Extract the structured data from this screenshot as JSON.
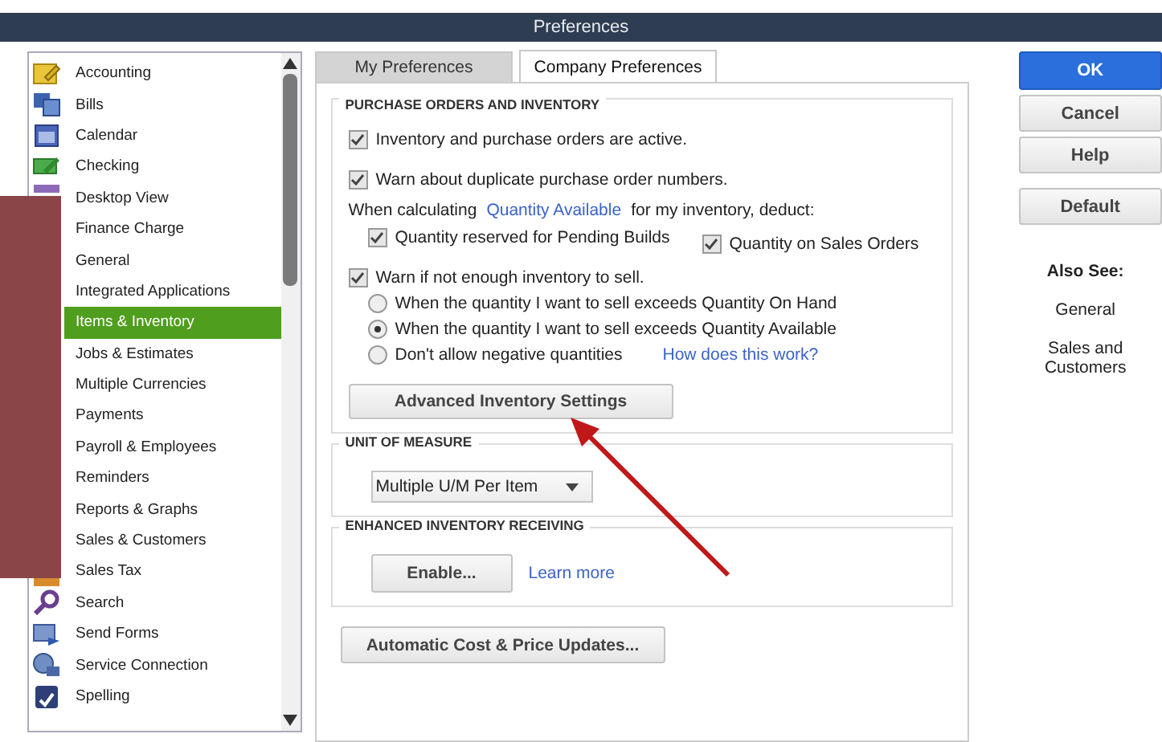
{
  "window": {
    "title": "Preferences"
  },
  "categories": [
    {
      "label": "Accounting",
      "kind": "ledger",
      "selected": false
    },
    {
      "label": "Bills",
      "kind": "bills",
      "selected": false
    },
    {
      "label": "Calendar",
      "kind": "calendar",
      "selected": false
    },
    {
      "label": "Checking",
      "kind": "check",
      "selected": false
    },
    {
      "label": "Desktop View",
      "kind": "screen",
      "selected": false
    },
    {
      "label": "Finance Charge",
      "selected": false
    },
    {
      "label": "General",
      "selected": false
    },
    {
      "label": "Integrated Applications",
      "selected": false
    },
    {
      "label": "Items & Inventory",
      "selected": true
    },
    {
      "label": "Jobs & Estimates",
      "selected": false
    },
    {
      "label": "Multiple Currencies",
      "selected": false
    },
    {
      "label": "Payments",
      "selected": false
    },
    {
      "label": "Payroll & Employees",
      "selected": false
    },
    {
      "label": "Reminders",
      "selected": false
    },
    {
      "label": "Reports & Graphs",
      "selected": false
    },
    {
      "label": "Sales & Customers",
      "selected": false
    },
    {
      "label": "Sales Tax",
      "kind": "tax",
      "selected": false
    },
    {
      "label": "Search",
      "kind": "search",
      "selected": false
    },
    {
      "label": "Send Forms",
      "kind": "send",
      "selected": false
    },
    {
      "label": "Service Connection",
      "kind": "network",
      "selected": false
    },
    {
      "label": "Spelling",
      "kind": "spelling",
      "selected": false
    }
  ],
  "tabs": [
    {
      "label": "My Preferences",
      "selected": false
    },
    {
      "label": "Company Preferences",
      "selected": true
    }
  ],
  "purchase_orders": {
    "heading": "PURCHASE ORDERS AND INVENTORY",
    "options": [
      {
        "label": "Inventory and purchase orders are active.",
        "checked": true
      },
      {
        "label": "Warn about duplicate purchase order numbers.",
        "checked": true
      }
    ],
    "deduct": {
      "prefix": "When calculating",
      "link": "Quantity Available",
      "suffix": "for my inventory, deduct:",
      "options": [
        {
          "label": "Quantity reserved for Pending Builds",
          "checked": true
        },
        {
          "label": "Quantity on Sales Orders",
          "checked": true
        }
      ]
    },
    "warn": {
      "label": "Warn if not enough inventory to sell.",
      "checked": true,
      "choices": [
        {
          "label": "When the quantity I want to sell exceeds Quantity On Hand",
          "selected": false
        },
        {
          "label": "When the quantity I want to sell exceeds Quantity Available",
          "selected": true
        },
        {
          "label": "Don't allow negative quantities",
          "selected": false
        }
      ],
      "help_link": "How does this work?"
    },
    "advanced_button": "Advanced Inventory Settings"
  },
  "unit_of_measure": {
    "heading": "UNIT OF MEASURE",
    "value": "Multiple U/M Per Item"
  },
  "receiving": {
    "heading": "ENHANCED INVENTORY RECEIVING",
    "button": "Enable...",
    "link": "Learn more"
  },
  "cost_button": "Automatic Cost & Price Updates...",
  "buttons": [
    {
      "label": "OK",
      "primary": true
    },
    {
      "label": "Cancel",
      "primary": false
    },
    {
      "label": "Help",
      "primary": false
    },
    {
      "label": "Default",
      "primary": false
    }
  ],
  "also_see": {
    "heading": "Also See:",
    "links": [
      "General",
      "Sales and Customers"
    ]
  }
}
